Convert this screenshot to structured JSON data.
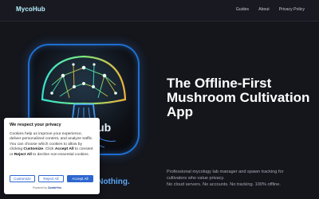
{
  "header": {
    "brand": "MycoHub",
    "nav": [
      "Guides",
      "About",
      "Privacy Policy"
    ]
  },
  "hero": {
    "brand_partial": "Hub",
    "tagline_partial": "re Nothing.",
    "title": "The Offline-First Mushroom Cultivation App",
    "description_lines": [
      "Professional mycology lab manager and spawn tracking for",
      "cultivators who value privacy.",
      "No cloud servers. No accounts. No tracking. 100% offline."
    ]
  },
  "cookie": {
    "title": "We respect your privacy",
    "text_1": "Cookies help us improve your experience, deliver personalized content, and analyze traffic. You can choose which cookies to allow by clicking ",
    "customize_word": "Customize",
    "text_2": ". Click ",
    "accept_word": "Accept All",
    "text_3": " to consent or ",
    "reject_word": "Reject All",
    "text_4": " to decline non-essential cookies.",
    "buttons": {
      "customize": "Customize",
      "reject": "Reject All",
      "accept": "Accept All"
    },
    "powered_prefix": "Powered by",
    "powered_brand": "CookieYes"
  },
  "colors": {
    "background": "#15161c",
    "brand": "#b8f0ff",
    "accent_blue": "#2d66d0",
    "tagline_blue": "#5aa6f5"
  },
  "icons": [
    "mushroom-network-icon"
  ]
}
